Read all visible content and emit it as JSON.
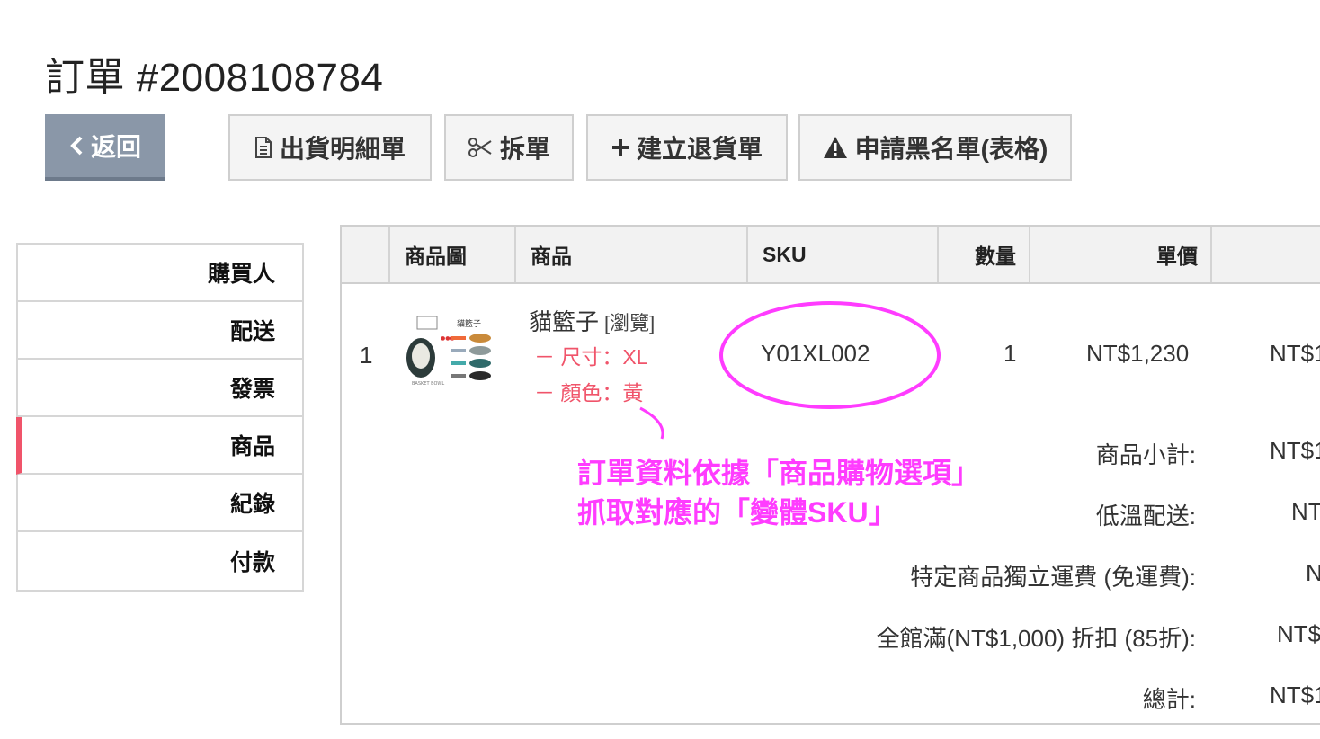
{
  "order": {
    "title": "訂單 #2008108784"
  },
  "toolbar": {
    "back_label": "返回",
    "shipping_label": "出貨明細單",
    "split_label": "拆單",
    "return_label": "建立退貨單",
    "blacklist_label": "申請黑名單(表格)"
  },
  "sidebar": {
    "items": [
      {
        "label": "購買人"
      },
      {
        "label": "配送"
      },
      {
        "label": "發票"
      },
      {
        "label": "商品",
        "active": true
      },
      {
        "label": "紀錄"
      },
      {
        "label": "付款"
      }
    ],
    "accent_color": "#f0546a"
  },
  "table": {
    "headers": [
      "商品圖",
      "商品",
      "SKU",
      "數量",
      "單價"
    ],
    "rows": [
      {
        "index": "1",
        "name": "貓籃子",
        "view_link": "[瀏覽]",
        "options": [
          "－ 尺寸：XL",
          "－ 顏色：黃"
        ],
        "sku": "Y01XL002",
        "qty": "1",
        "price": "NT$1,230",
        "total_partial": "NT$1"
      }
    ]
  },
  "summary": [
    {
      "label": "商品小計:",
      "value_partial": "NT$1"
    },
    {
      "label": "低溫配送:",
      "value_partial": "NT"
    },
    {
      "label": "特定商品獨立運費 (免運費):",
      "value_partial": "N"
    },
    {
      "label": "全館滿(NT$1,000) 折扣 (85折):",
      "value_partial": "NT$"
    },
    {
      "label": "總計:",
      "value_partial": "NT$1"
    }
  ],
  "annotation": {
    "line1": "訂單資料依據「商品購物選項」",
    "line2": "抓取對應的「變體SKU」",
    "color": "#ff3cff"
  },
  "thumbnail": {
    "caption": "貓籃子",
    "sub": "BASKET BOWL"
  }
}
